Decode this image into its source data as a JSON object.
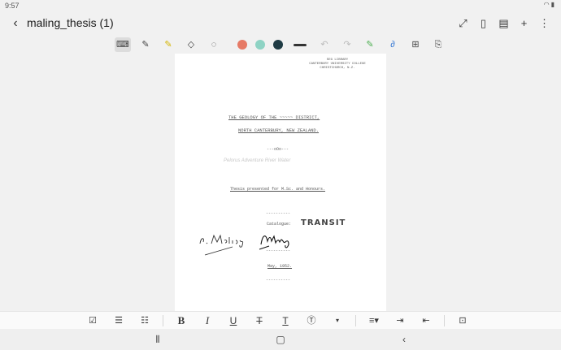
{
  "status_bar": {
    "time": "9:57"
  },
  "header": {
    "title": "maling_thesis (1)",
    "icons": [
      "back-icon",
      "expand-icon",
      "book-view-icon",
      "page-list-icon",
      "add-icon",
      "more-icon"
    ]
  },
  "pen_toolbar": {
    "colors": [
      "#e67a66",
      "#8ed3c4",
      "#1f3b44"
    ],
    "tools": [
      "keyboard-icon",
      "pen-icon",
      "highlighter-icon",
      "eraser-icon",
      "lasso-icon",
      "undo-icon",
      "redo-icon",
      "pen-settings-icon",
      "shape-icon",
      "text-box-icon",
      "insert-icon"
    ]
  },
  "document": {
    "library_stamp": [
      "SEG LIBRARY",
      "CANTERBURY UNIVERSITY COLLEGE",
      "CHRISTCHURCH, N.Z."
    ],
    "title_line1": "THE GEOLOGY OF THE ~~~~~ DISTRICT,",
    "title_line2": "NORTH CANTERBURY, NEW ZEALAND.",
    "dash1": "---oOo---",
    "faint_text": "Pelorus Adventure River Water",
    "thesis_note": "Thesis presented for M.Sc. and Honours.",
    "dash2": "----------",
    "catalogue": "Catalogue:",
    "stamp": "TRANSIT",
    "signature1": "P.B. Maling",
    "signature2": "P.B. Maling",
    "dash3": "----------",
    "date": "May, 1952.",
    "dash4": "----------"
  },
  "format_bar": {
    "items": [
      "checkbox-icon",
      "numbered-list-icon",
      "bullet-list-icon",
      "B",
      "I",
      "U",
      "T",
      "T",
      "text-style-icon",
      "align-icon",
      "indent-icon",
      "outdent-icon",
      "text-recognize-icon"
    ]
  },
  "nav_bar": {
    "items": [
      "recent-apps-icon",
      "home-icon",
      "back-nav-icon"
    ]
  }
}
